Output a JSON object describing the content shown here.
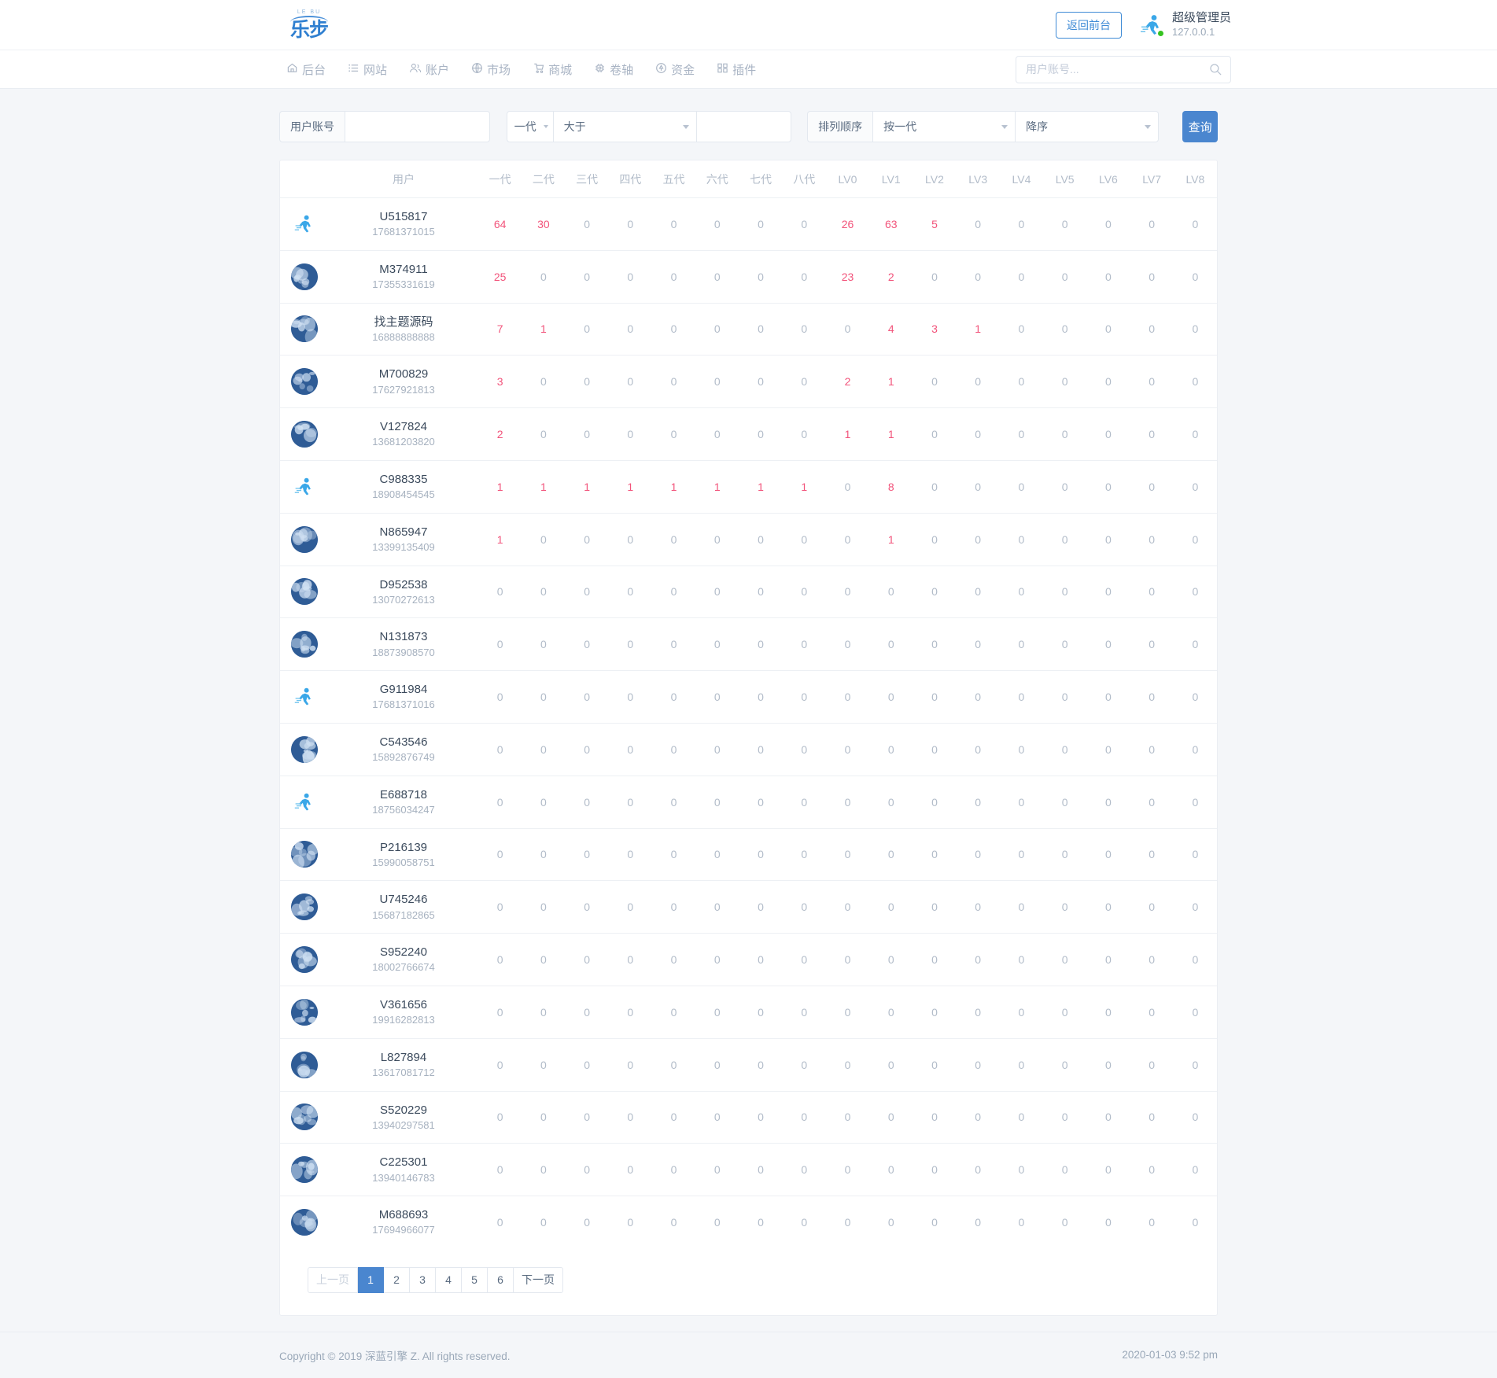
{
  "brand": {
    "sub": "LE BU",
    "name": "乐步"
  },
  "header": {
    "front_button": "返回前台",
    "user_name": "超级管理员",
    "user_ip": "127.0.0.1",
    "avatar_icon": "runner-icon",
    "status_dot_color": "#36c320"
  },
  "nav": {
    "items": [
      {
        "label": "后台",
        "icon": "home-icon"
      },
      {
        "label": "网站",
        "icon": "list-icon"
      },
      {
        "label": "账户",
        "icon": "users-icon"
      },
      {
        "label": "市场",
        "icon": "globe-icon"
      },
      {
        "label": "商城",
        "icon": "cart-icon"
      },
      {
        "label": "卷轴",
        "icon": "chip-icon"
      },
      {
        "label": "资金",
        "icon": "coin-icon"
      },
      {
        "label": "插件",
        "icon": "grid-icon"
      }
    ]
  },
  "search": {
    "placeholder": "用户账号...",
    "value": "",
    "icon": "search-icon"
  },
  "filters": {
    "account_label": "用户账号",
    "account_value": "",
    "account_placeholder": "",
    "gen_select": "一代",
    "cmp_select": "大于",
    "cmp_value": "",
    "order_label": "排列顺序",
    "order_by": "按一代",
    "order_dir": "降序",
    "query_button": "查询"
  },
  "table": {
    "columns": [
      "用户",
      "一代",
      "二代",
      "三代",
      "四代",
      "五代",
      "六代",
      "七代",
      "八代",
      "LV0",
      "LV1",
      "LV2",
      "LV3",
      "LV4",
      "LV5",
      "LV6",
      "LV7",
      "LV8"
    ],
    "rows": [
      {
        "avatar": "runner-icon",
        "name": "U515817",
        "phone": "17681371015",
        "values": [
          64,
          30,
          0,
          0,
          0,
          0,
          0,
          0,
          26,
          63,
          5,
          0,
          0,
          0,
          0,
          0,
          0
        ]
      },
      {
        "avatar": "photo-avatar",
        "name": "M374911",
        "phone": "17355331619",
        "values": [
          25,
          0,
          0,
          0,
          0,
          0,
          0,
          0,
          23,
          2,
          0,
          0,
          0,
          0,
          0,
          0,
          0
        ]
      },
      {
        "avatar": "photo-avatar",
        "name": "找主题源码",
        "phone": "16888888888",
        "values": [
          7,
          1,
          0,
          0,
          0,
          0,
          0,
          0,
          0,
          4,
          3,
          1,
          0,
          0,
          0,
          0,
          0
        ]
      },
      {
        "avatar": "photo-avatar",
        "name": "M700829",
        "phone": "17627921813",
        "values": [
          3,
          0,
          0,
          0,
          0,
          0,
          0,
          0,
          2,
          1,
          0,
          0,
          0,
          0,
          0,
          0,
          0
        ]
      },
      {
        "avatar": "photo-avatar",
        "name": "V127824",
        "phone": "13681203820",
        "values": [
          2,
          0,
          0,
          0,
          0,
          0,
          0,
          0,
          1,
          1,
          0,
          0,
          0,
          0,
          0,
          0,
          0
        ]
      },
      {
        "avatar": "runner-icon",
        "name": "C988335",
        "phone": "18908454545",
        "values": [
          1,
          1,
          1,
          1,
          1,
          1,
          1,
          1,
          0,
          8,
          0,
          0,
          0,
          0,
          0,
          0,
          0
        ]
      },
      {
        "avatar": "photo-avatar",
        "name": "N865947",
        "phone": "13399135409",
        "values": [
          1,
          0,
          0,
          0,
          0,
          0,
          0,
          0,
          0,
          1,
          0,
          0,
          0,
          0,
          0,
          0,
          0
        ]
      },
      {
        "avatar": "photo-avatar",
        "name": "D952538",
        "phone": "13070272613",
        "values": [
          0,
          0,
          0,
          0,
          0,
          0,
          0,
          0,
          0,
          0,
          0,
          0,
          0,
          0,
          0,
          0,
          0
        ]
      },
      {
        "avatar": "photo-avatar",
        "name": "N131873",
        "phone": "18873908570",
        "values": [
          0,
          0,
          0,
          0,
          0,
          0,
          0,
          0,
          0,
          0,
          0,
          0,
          0,
          0,
          0,
          0,
          0
        ]
      },
      {
        "avatar": "runner-icon",
        "name": "G911984",
        "phone": "17681371016",
        "values": [
          0,
          0,
          0,
          0,
          0,
          0,
          0,
          0,
          0,
          0,
          0,
          0,
          0,
          0,
          0,
          0,
          0
        ]
      },
      {
        "avatar": "photo-avatar",
        "name": "C543546",
        "phone": "15892876749",
        "values": [
          0,
          0,
          0,
          0,
          0,
          0,
          0,
          0,
          0,
          0,
          0,
          0,
          0,
          0,
          0,
          0,
          0
        ]
      },
      {
        "avatar": "runner-icon",
        "name": "E688718",
        "phone": "18756034247",
        "values": [
          0,
          0,
          0,
          0,
          0,
          0,
          0,
          0,
          0,
          0,
          0,
          0,
          0,
          0,
          0,
          0,
          0
        ]
      },
      {
        "avatar": "photo-avatar",
        "name": "P216139",
        "phone": "15990058751",
        "values": [
          0,
          0,
          0,
          0,
          0,
          0,
          0,
          0,
          0,
          0,
          0,
          0,
          0,
          0,
          0,
          0,
          0
        ]
      },
      {
        "avatar": "photo-avatar",
        "name": "U745246",
        "phone": "15687182865",
        "values": [
          0,
          0,
          0,
          0,
          0,
          0,
          0,
          0,
          0,
          0,
          0,
          0,
          0,
          0,
          0,
          0,
          0
        ]
      },
      {
        "avatar": "photo-avatar",
        "name": "S952240",
        "phone": "18002766674",
        "values": [
          0,
          0,
          0,
          0,
          0,
          0,
          0,
          0,
          0,
          0,
          0,
          0,
          0,
          0,
          0,
          0,
          0
        ]
      },
      {
        "avatar": "photo-avatar",
        "name": "V361656",
        "phone": "19916282813",
        "values": [
          0,
          0,
          0,
          0,
          0,
          0,
          0,
          0,
          0,
          0,
          0,
          0,
          0,
          0,
          0,
          0,
          0
        ]
      },
      {
        "avatar": "photo-avatar",
        "name": "L827894",
        "phone": "13617081712",
        "values": [
          0,
          0,
          0,
          0,
          0,
          0,
          0,
          0,
          0,
          0,
          0,
          0,
          0,
          0,
          0,
          0,
          0
        ]
      },
      {
        "avatar": "photo-avatar",
        "name": "S520229",
        "phone": "13940297581",
        "values": [
          0,
          0,
          0,
          0,
          0,
          0,
          0,
          0,
          0,
          0,
          0,
          0,
          0,
          0,
          0,
          0,
          0
        ]
      },
      {
        "avatar": "photo-avatar",
        "name": "C225301",
        "phone": "13940146783",
        "values": [
          0,
          0,
          0,
          0,
          0,
          0,
          0,
          0,
          0,
          0,
          0,
          0,
          0,
          0,
          0,
          0,
          0
        ]
      },
      {
        "avatar": "photo-avatar",
        "name": "M688693",
        "phone": "17694966077",
        "values": [
          0,
          0,
          0,
          0,
          0,
          0,
          0,
          0,
          0,
          0,
          0,
          0,
          0,
          0,
          0,
          0,
          0
        ]
      }
    ]
  },
  "pagination": {
    "prev": "上一页",
    "next": "下一页",
    "pages": [
      "1",
      "2",
      "3",
      "4",
      "5",
      "6"
    ],
    "active": "1",
    "prev_disabled": true
  },
  "footer": {
    "copyright": "Copyright © 2019 深蓝引擎 Z. All rights reserved.",
    "datetime": "2020-01-03 9:52 pm"
  },
  "colors": {
    "accent": "#4a86cf",
    "hot": "#f2547b",
    "muted": "#b2bcc9",
    "avatar_bg": "#2f5c96"
  }
}
